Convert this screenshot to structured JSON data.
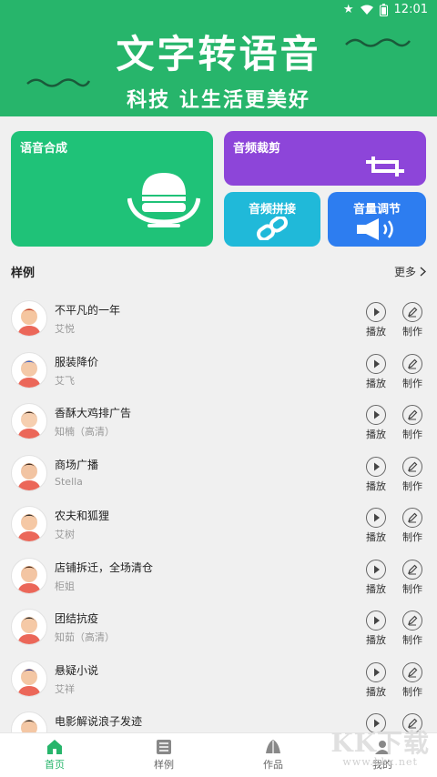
{
  "status": {
    "time": "12:01"
  },
  "hero": {
    "title": "文字转语音",
    "slogan": "科技  让生活更美好"
  },
  "cards": {
    "synth": "语音合成",
    "cut": "音频裁剪",
    "join": "音频拼接",
    "volume": "音量调节"
  },
  "section": {
    "title": "样例",
    "more": "更多"
  },
  "actions": {
    "play": "播放",
    "make": "制作"
  },
  "samples": [
    {
      "name": "不平凡的一年",
      "voice": "艾悦"
    },
    {
      "name": "服装降价",
      "voice": "艾飞"
    },
    {
      "name": "香酥大鸡排广告",
      "voice": "知楠（高清）"
    },
    {
      "name": "商场广播",
      "voice": "Stella"
    },
    {
      "name": "农夫和狐狸",
      "voice": "艾树"
    },
    {
      "name": "店铺拆迁，全场清仓",
      "voice": "柜姐"
    },
    {
      "name": "团结抗疫",
      "voice": "知茹（高清）"
    },
    {
      "name": "悬疑小说",
      "voice": "艾祥"
    },
    {
      "name": "电影解说浪子发迹",
      "voice": ""
    }
  ],
  "tabs": [
    "首页",
    "样例",
    "作品",
    "我的"
  ],
  "watermark": {
    "main": "KK下载",
    "sub": "www.kkx.net"
  },
  "colors": {
    "brand": "#27b56b",
    "synth": "#1fc278",
    "cut": "#8d45d9",
    "join": "#20b9d9",
    "volume": "#2d7df0"
  }
}
